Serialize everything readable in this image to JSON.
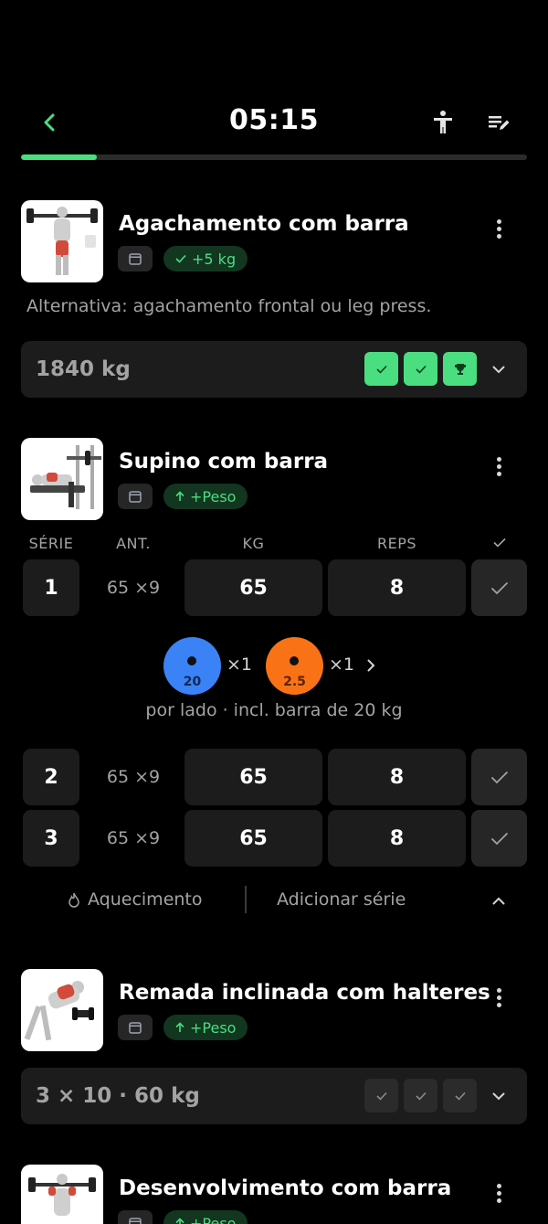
{
  "header": {
    "timer": "05:15",
    "progress_fraction": 0.15
  },
  "exercises": [
    {
      "title": "Agachamento com barra",
      "tag": "+5 kg",
      "tag_icon": "check-icon",
      "note": "Alternativa: agachamento frontal ou leg press.",
      "summary": "1840 kg",
      "sets_status": [
        "done",
        "done",
        "trophy"
      ]
    },
    {
      "title": "Supino com barra",
      "tag": "+Peso",
      "tag_icon": "arrow-up-icon",
      "columns": [
        "SÉRIE",
        "ANT.",
        "KG",
        "REPS"
      ],
      "sets": [
        {
          "num": "1",
          "prev": "65 ×9",
          "kg": "65",
          "reps": "8"
        },
        {
          "num": "2",
          "prev": "65 ×9",
          "kg": "65",
          "reps": "8"
        },
        {
          "num": "3",
          "prev": "65 ×9",
          "kg": "65",
          "reps": "8"
        }
      ],
      "plates": [
        {
          "weight": "20",
          "count": "×1",
          "color": "#3b82f6"
        },
        {
          "weight": "2.5",
          "count": "×1",
          "color": "#f97316"
        }
      ],
      "plate_note": "por lado · incl. barra de 20 kg",
      "warmup_label": "Aquecimento",
      "add_set_label": "Adicionar série"
    },
    {
      "title": "Remada inclinada com halteres",
      "tag": "+Peso",
      "tag_icon": "arrow-up-icon",
      "summary": "3 × 10 · 60 kg",
      "sets_status": [
        "pending",
        "pending",
        "pending"
      ]
    },
    {
      "title": "Desenvolvimento com barra",
      "tag": "+Peso",
      "tag_icon": "arrow-up-icon"
    }
  ],
  "colors": {
    "accent": "#4ade80",
    "tag_bg": "#12361f",
    "card_bg": "#1c1c1c"
  }
}
